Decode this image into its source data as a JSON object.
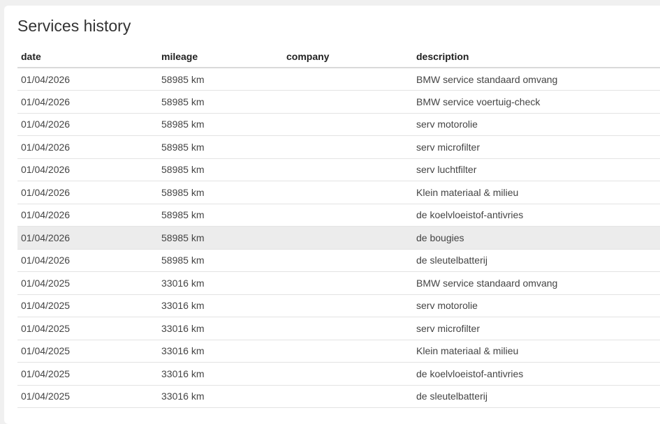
{
  "section": {
    "title": "Services history"
  },
  "table": {
    "columns": [
      "date",
      "mileage",
      "company",
      "description"
    ],
    "highlighted_row": 7,
    "rows": [
      {
        "date": "01/04/2026",
        "mileage": "58985 km",
        "company": "",
        "description": "BMW service standaard omvang"
      },
      {
        "date": "01/04/2026",
        "mileage": "58985 km",
        "company": "",
        "description": "BMW service voertuig-check"
      },
      {
        "date": "01/04/2026",
        "mileage": "58985 km",
        "company": "",
        "description": "serv motorolie"
      },
      {
        "date": "01/04/2026",
        "mileage": "58985 km",
        "company": "",
        "description": "serv microfilter"
      },
      {
        "date": "01/04/2026",
        "mileage": "58985 km",
        "company": "",
        "description": "serv luchtfilter"
      },
      {
        "date": "01/04/2026",
        "mileage": "58985 km",
        "company": "",
        "description": "Klein materiaal & milieu"
      },
      {
        "date": "01/04/2026",
        "mileage": "58985 km",
        "company": "",
        "description": "de koelvloeistof-antivries"
      },
      {
        "date": "01/04/2026",
        "mileage": "58985 km",
        "company": "",
        "description": "de bougies"
      },
      {
        "date": "01/04/2026",
        "mileage": "58985 km",
        "company": "",
        "description": "de sleutelbatterij"
      },
      {
        "date": "01/04/2025",
        "mileage": "33016 km",
        "company": "",
        "description": "BMW service standaard omvang"
      },
      {
        "date": "01/04/2025",
        "mileage": "33016 km",
        "company": "",
        "description": "serv motorolie"
      },
      {
        "date": "01/04/2025",
        "mileage": "33016 km",
        "company": "",
        "description": "serv microfilter"
      },
      {
        "date": "01/04/2025",
        "mileage": "33016 km",
        "company": "",
        "description": "Klein materiaal & milieu"
      },
      {
        "date": "01/04/2025",
        "mileage": "33016 km",
        "company": "",
        "description": "de koelvloeistof-antivries"
      },
      {
        "date": "01/04/2025",
        "mileage": "33016 km",
        "company": "",
        "description": "de sleutelbatterij"
      }
    ]
  }
}
